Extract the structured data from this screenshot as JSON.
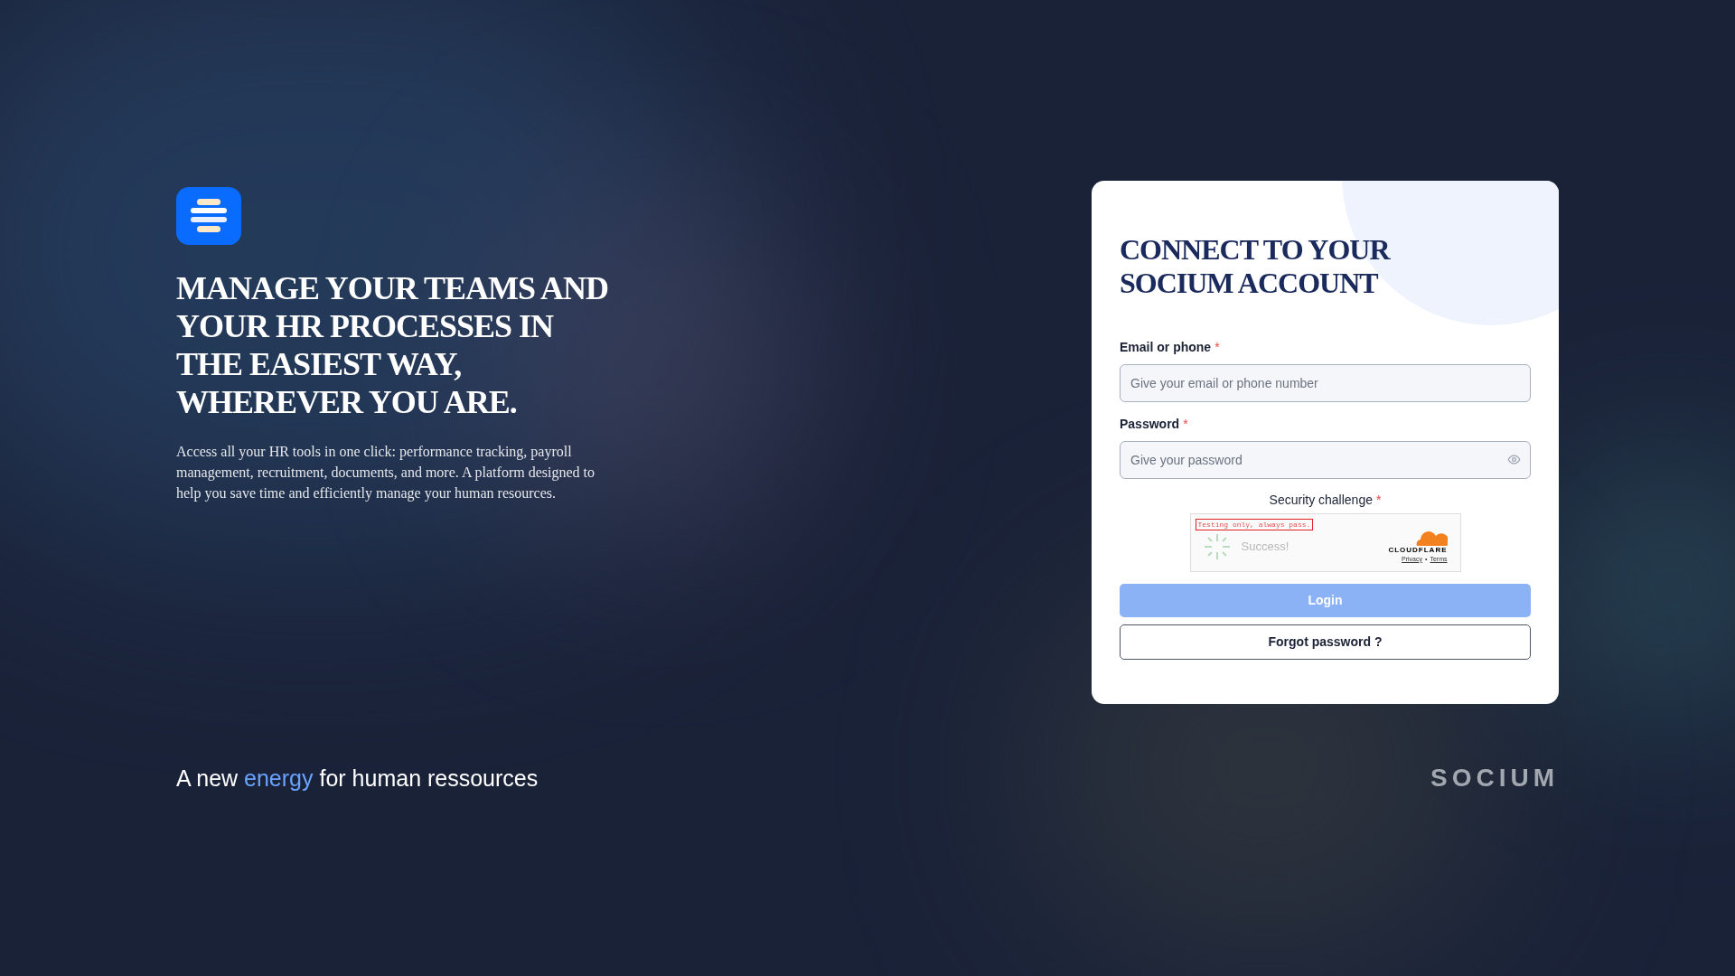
{
  "hero": {
    "heading": "MANAGE YOUR TEAMS AND YOUR HR PROCESSES IN THE EASIEST WAY, WHEREVER YOU ARE.",
    "description": "Access all your HR tools in one click: performance tracking, payroll management, recruitment, documents, and more. A platform designed to help you save time and efficiently manage your human resources."
  },
  "login_card": {
    "title": "CONNECT TO YOUR SOCIUM ACCOUNT",
    "fields": [
      {
        "label": "Email or phone",
        "required_mark": "*",
        "placeholder": "Give your email or phone number",
        "kind": "text"
      },
      {
        "label": "Password",
        "required_mark": "*",
        "placeholder": "Give your password",
        "kind": "password"
      }
    ],
    "challenge": {
      "label": "Security challenge",
      "required_mark": "*",
      "test_notice": "Testing only, always pass.",
      "status": "Success!",
      "provider": "CLOUDFLARE",
      "links": [
        "Privacy",
        "Terms"
      ],
      "separator": "•"
    },
    "login_button": {
      "label": "Login",
      "disabled": true
    },
    "forgot_button": {
      "label": "Forgot password ?"
    }
  },
  "footer": {
    "tagline_before": "A new",
    "tagline_highlight": "energy",
    "tagline_after": "for human ressources",
    "brand": "SOCIUM"
  }
}
